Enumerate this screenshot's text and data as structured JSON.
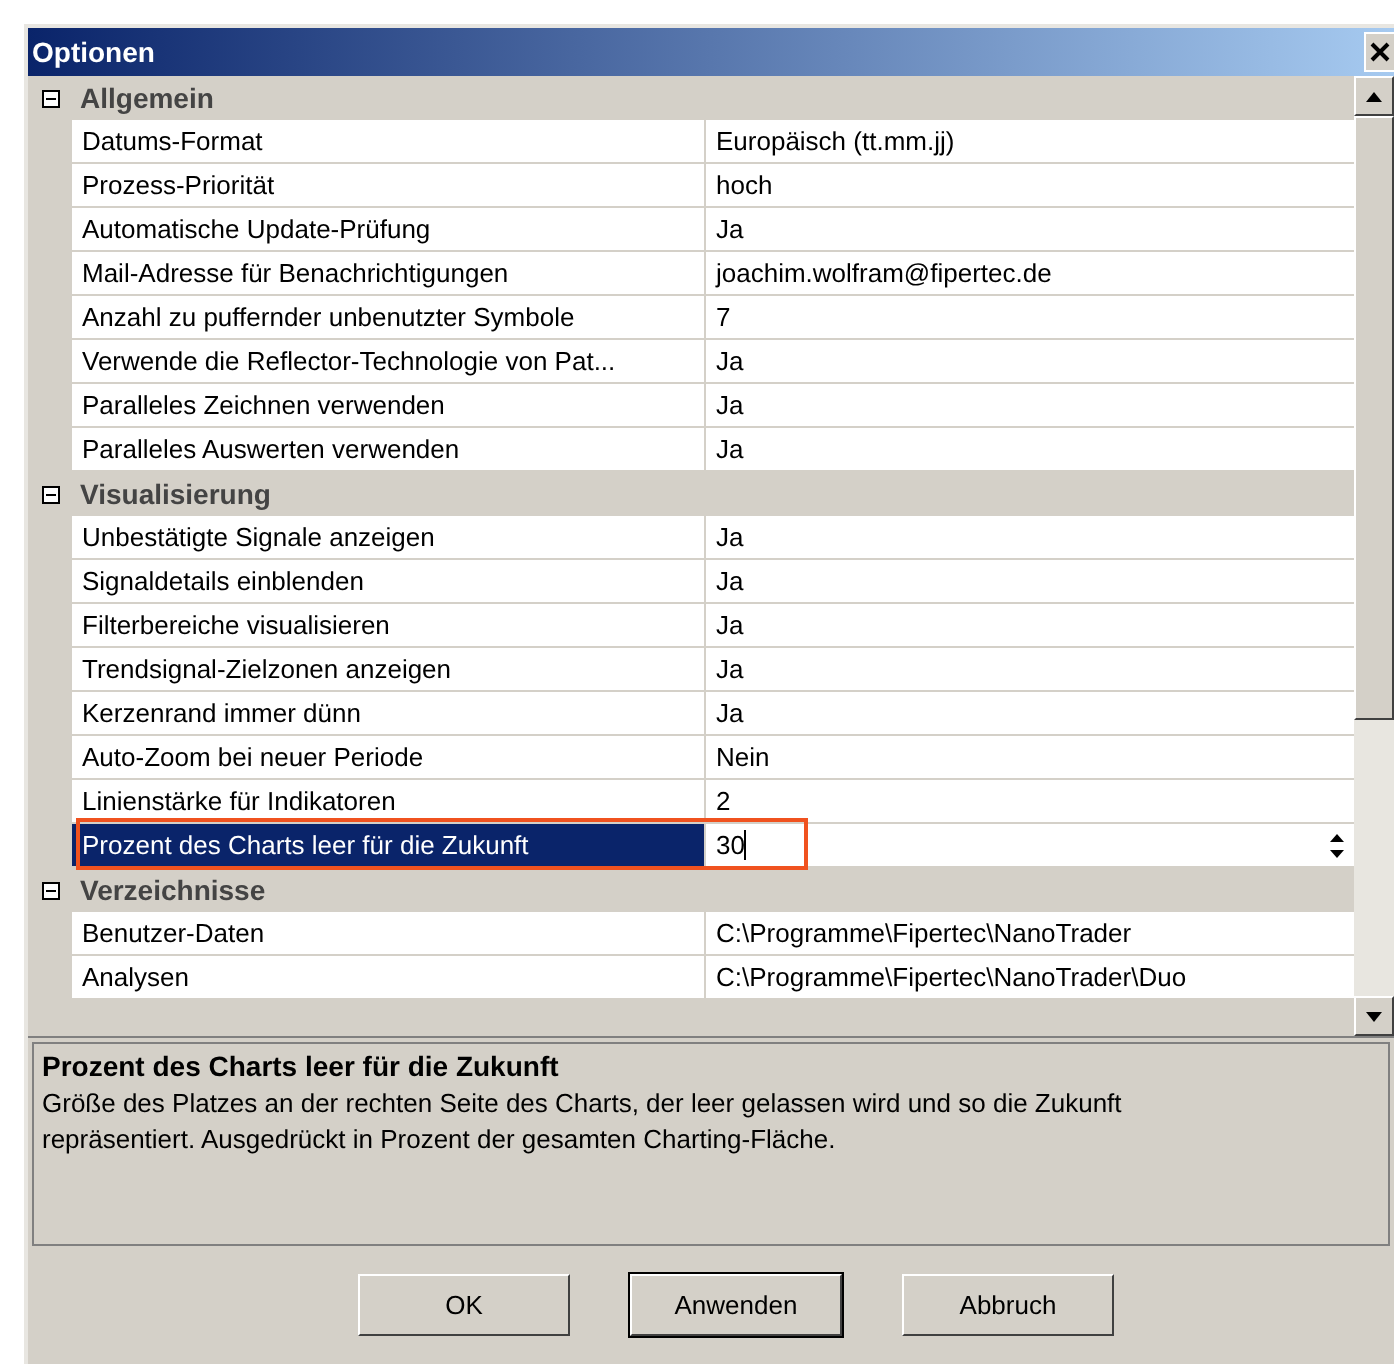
{
  "window": {
    "title": "Optionen"
  },
  "sections": [
    {
      "title": "Allgemein",
      "expanded": true,
      "rows": [
        {
          "name": "Datums-Format",
          "value": "Europäisch (tt.mm.jj)",
          "selected": false
        },
        {
          "name": "Prozess-Priorität",
          "value": "hoch",
          "selected": false
        },
        {
          "name": "Automatische Update-Prüfung",
          "value": "Ja",
          "selected": false
        },
        {
          "name": "Mail-Adresse für Benachrichtigungen",
          "value": "joachim.wolfram@fipertec.de",
          "selected": false
        },
        {
          "name": "Anzahl zu puffernder unbenutzter Symbole",
          "value": "7",
          "selected": false
        },
        {
          "name": "Verwende die Reflector-Technologie von Pat...",
          "value": "Ja",
          "selected": false
        },
        {
          "name": "Paralleles Zeichnen verwenden",
          "value": "Ja",
          "selected": false
        },
        {
          "name": "Paralleles Auswerten verwenden",
          "value": "Ja",
          "selected": false
        }
      ]
    },
    {
      "title": "Visualisierung",
      "expanded": true,
      "rows": [
        {
          "name": "Unbestätigte Signale anzeigen",
          "value": "Ja",
          "selected": false
        },
        {
          "name": "Signaldetails einblenden",
          "value": "Ja",
          "selected": false
        },
        {
          "name": "Filterbereiche visualisieren",
          "value": "Ja",
          "selected": false
        },
        {
          "name": "Trendsignal-Zielzonen anzeigen",
          "value": "Ja",
          "selected": false
        },
        {
          "name": "Kerzenrand immer dünn",
          "value": "Ja",
          "selected": false
        },
        {
          "name": "Auto-Zoom bei neuer Periode",
          "value": "Nein",
          "selected": false
        },
        {
          "name": "Linienstärke für Indikatoren",
          "value": "2",
          "selected": false
        },
        {
          "name": "Prozent des Charts leer für die Zukunft",
          "value": "30",
          "selected": true
        }
      ]
    },
    {
      "title": "Verzeichnisse",
      "expanded": true,
      "rows": [
        {
          "name": "Benutzer-Daten",
          "value": "C:\\Programme\\Fipertec\\NanoTrader",
          "selected": false
        },
        {
          "name": "Analysen",
          "value": "C:\\Programme\\Fipertec\\NanoTrader\\Duo",
          "selected": false
        }
      ]
    }
  ],
  "description": {
    "title": "Prozent des Charts leer für die Zukunft",
    "text": "Größe des Platzes an der rechten Seite des Charts, der leer gelassen wird und so die Zukunft repräsentiert. Ausgedrückt in Prozent der gesamten Charting-Fläche."
  },
  "buttons": [
    {
      "label": "OK",
      "default": false
    },
    {
      "label": "Anwenden",
      "default": true
    },
    {
      "label": "Abbruch",
      "default": false
    }
  ]
}
